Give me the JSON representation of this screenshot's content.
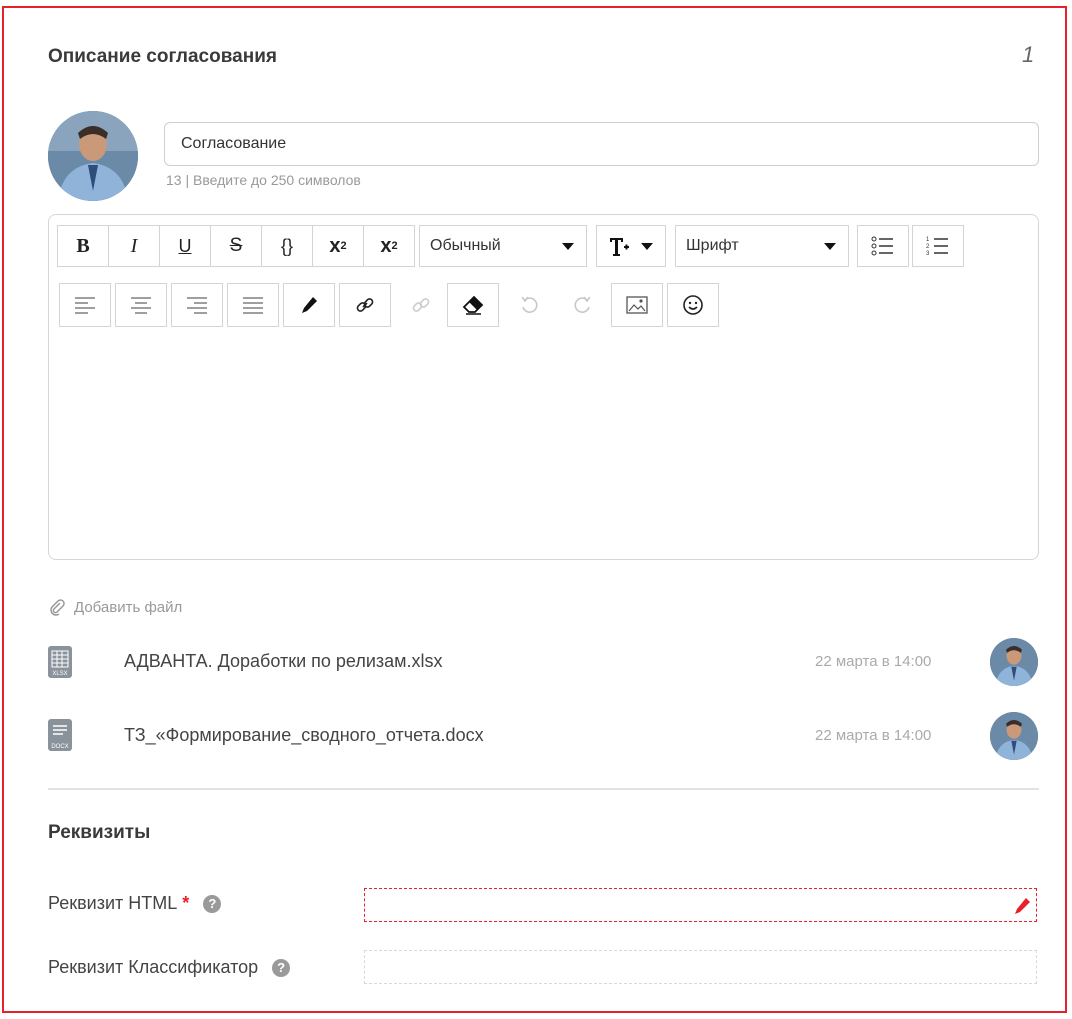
{
  "header": {
    "title": "Описание согласования",
    "number": "1"
  },
  "name_field": {
    "value": "Согласование",
    "counter": "13 | Введите до 250 символов"
  },
  "toolbar": {
    "format_value": "Обычный",
    "font_value": "Шрифт",
    "bold_label": "B",
    "italic_label": "I",
    "underline_label": "U",
    "strike_label": "S",
    "code_label": "{}",
    "sup_label": "x",
    "sup_mark": "2",
    "sub_label": "x",
    "sub_mark": "2"
  },
  "attachments": {
    "add_label": "Добавить файл",
    "files": [
      {
        "name": "АДВАНТА. Доработки по релизам.xlsx",
        "date": "22 марта в 14:00",
        "type": "XLSX"
      },
      {
        "name": "ТЗ_«Формирование_сводного_отчета.docx",
        "date": "22 марта в 14:00",
        "type": "DOCX"
      }
    ]
  },
  "requisites": {
    "title": "Реквизиты",
    "fields": [
      {
        "label": "Реквизит HTML",
        "required_mark": "*"
      },
      {
        "label": "Реквизит Классификатор"
      }
    ]
  },
  "colors": {
    "accent": "#e8202a",
    "border": "#d4d4d4",
    "muted": "#999999"
  }
}
